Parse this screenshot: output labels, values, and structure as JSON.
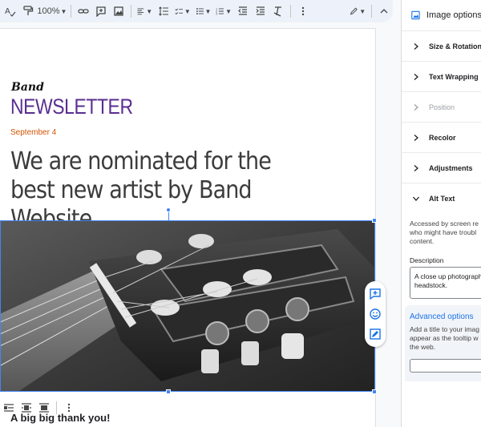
{
  "toolbar": {
    "zoom": "100%"
  },
  "document": {
    "logo_text": "Band",
    "masthead": "NEWSLETTER",
    "date": "September 4",
    "headline": "We are nominated for the best new artist by Band Website",
    "subheading": "A big big thank you!"
  },
  "panel": {
    "title": "Image options",
    "sections": [
      {
        "label": "Size & Rotation",
        "state": "collapsed"
      },
      {
        "label": "Text Wrapping",
        "state": "collapsed"
      },
      {
        "label": "Position",
        "state": "disabled"
      },
      {
        "label": "Recolor",
        "state": "collapsed"
      },
      {
        "label": "Adjustments",
        "state": "collapsed"
      },
      {
        "label": "Alt Text",
        "state": "expanded"
      }
    ],
    "alt_text": {
      "intro_line1": "Accessed by screen re",
      "intro_line2": "who might have troubl",
      "intro_line3": "content.",
      "description_label": "Description",
      "description_line1": "A close up photograph",
      "description_line2": "headstock.",
      "advanced_title": "Advanced options",
      "advanced_line1": "Add a title to your imag",
      "advanced_line2": "appear as the tooltip w",
      "advanced_line3": "the web."
    }
  },
  "colors": {
    "masthead": "#5a2d91",
    "date": "#d35400",
    "selection": "#4285f4",
    "link": "#1a73e8"
  }
}
